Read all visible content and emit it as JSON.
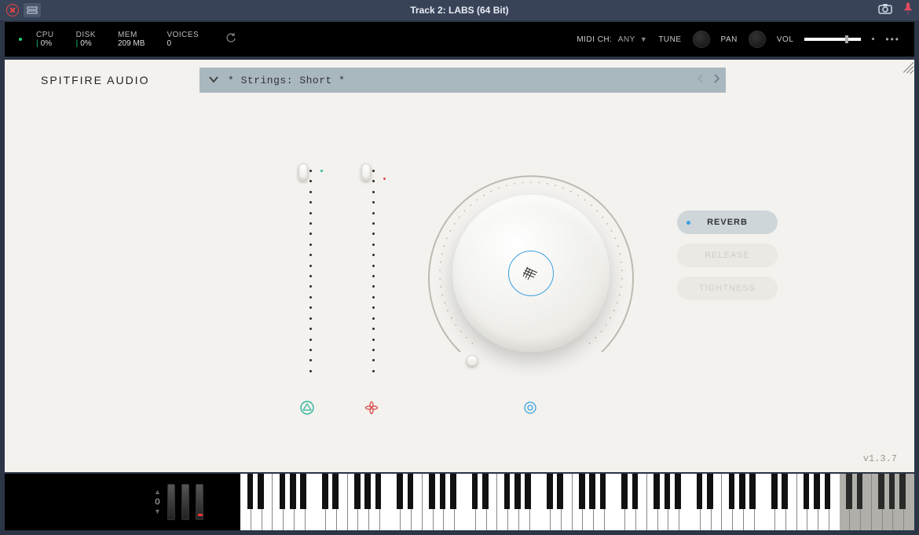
{
  "window": {
    "title": "Track 2: LABS (64 Bit)"
  },
  "status": {
    "cpu_label": "CPU",
    "cpu_value": "0%",
    "disk_label": "DISK",
    "disk_value": "0%",
    "mem_label": "MEM",
    "mem_value": "209 MB",
    "voices_label": "VOICES",
    "voices_value": "0",
    "midi_label": "MIDI CH:",
    "midi_value": "ANY",
    "tune_label": "TUNE",
    "pan_label": "PAN",
    "vol_label": "VOL"
  },
  "brand": "SPITFIRE AUDIO",
  "preset": {
    "name": "* Strings: Short *"
  },
  "selectors": {
    "reverb": "REVERB",
    "release": "RELEASE",
    "tightness": "TIGHTNESS"
  },
  "version": "v1.3.7",
  "keyboard": {
    "octave_value": "0"
  },
  "vol_slider_pct": 74
}
